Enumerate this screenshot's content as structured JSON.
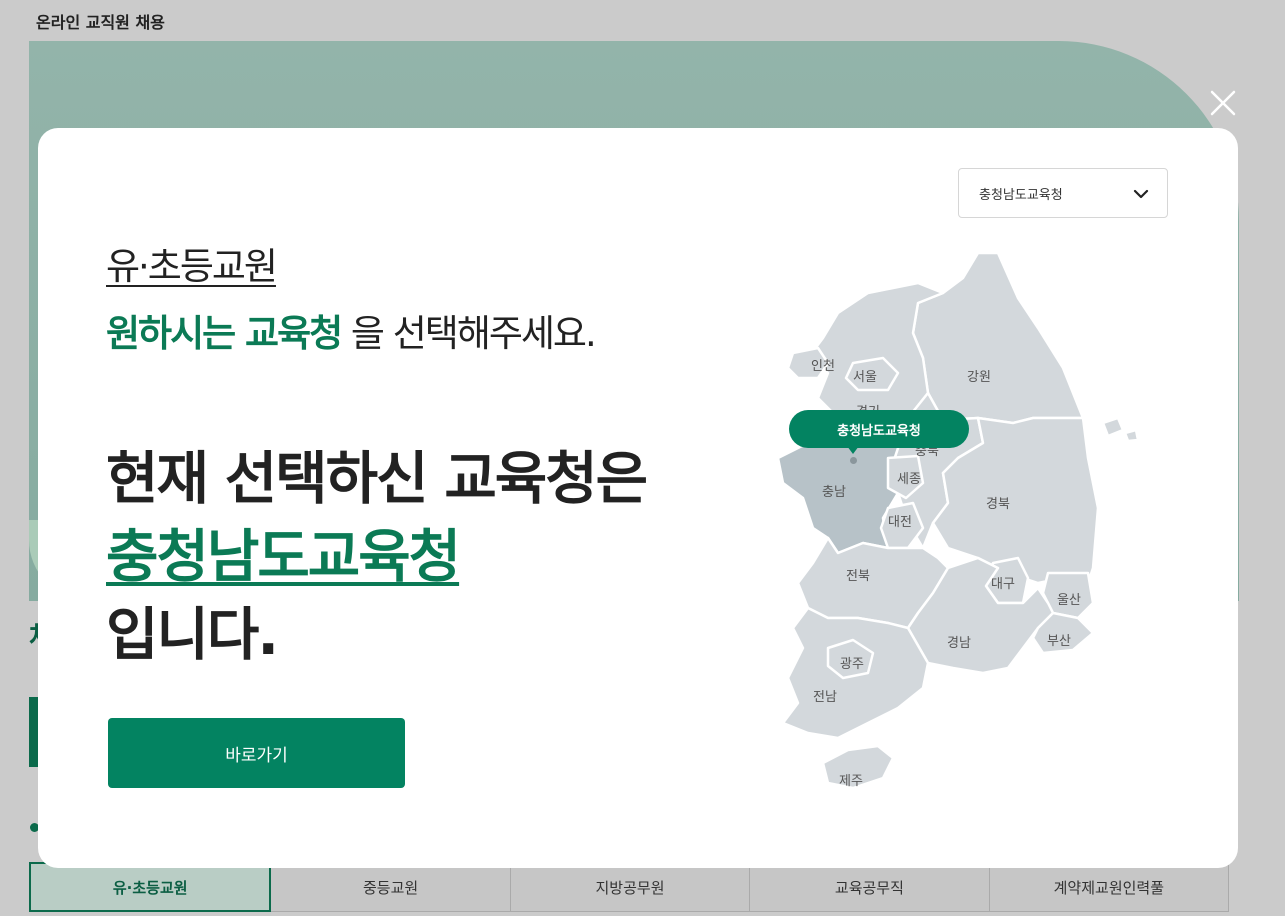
{
  "background": {
    "app_title": "온라인 교직원 채용",
    "tabs": [
      "유·초등교원",
      "중등교원",
      "지방공무원",
      "교육공무직",
      "계약제교원인력풀"
    ],
    "active_tab": 0
  },
  "modal": {
    "category": "유·초등교원",
    "prompt_highlight": "원하시는 교육청",
    "prompt_rest": " 을 선택해주세요.",
    "current_line1": "현재 선택하신 교육청은",
    "current_office": "충청남도교육청",
    "current_line3": "입니다.",
    "go_button_label": "바로가기",
    "office_select_value": "충청남도교육청",
    "close_icon": "close-icon",
    "chevron_icon": "chevron-down-icon"
  },
  "map": {
    "selected_tooltip": "충청남도교육청",
    "selected_region": "충남",
    "labels": {
      "incheon": "인천",
      "seoul": "서울",
      "gyeonggi": "경기",
      "gangwon": "강원",
      "chungbuk": "충북",
      "chungnam": "충남",
      "sejong": "세종",
      "daejeon": "대전",
      "gyeongbuk": "경북",
      "jeonbuk": "전북",
      "daegu": "대구",
      "ulsan": "울산",
      "gyeongnam": "경남",
      "busan": "부산",
      "gwangju": "광주",
      "jeonnam": "전남",
      "jeju": "제주"
    }
  },
  "colors": {
    "brand_green": "#038361",
    "highlight_text": "#0b7a55",
    "region_fill": "#d3d8dc",
    "region_selected": "#b7c2c8"
  }
}
